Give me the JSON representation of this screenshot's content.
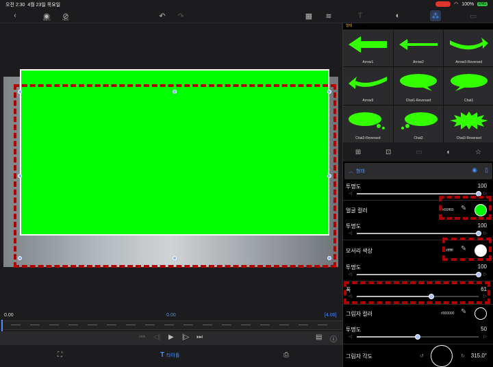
{
  "status_bar": {
    "time": "오전 2:30",
    "date": "4월 23일 목요일",
    "battery": "100%",
    "battery_badge": "ENG"
  },
  "toolbar": {
    "back_icon": "chevron-left-icon",
    "eye_label_1": "SOLO",
    "eye_label_2": "HIDE"
  },
  "timeline": {
    "start": "0.00",
    "current": "0.00",
    "end": "[4.00]",
    "title_tab": "타이틀"
  },
  "shape_panel": {
    "category": "형태",
    "shapes": [
      {
        "label": "Arrow1"
      },
      {
        "label": "Arrow2"
      },
      {
        "label": "Arrow3-Reversed"
      },
      {
        "label": "Arrow3"
      },
      {
        "label": "Chat1-Reversed"
      },
      {
        "label": "Chat1"
      },
      {
        "label": "Chat2-Reversed"
      },
      {
        "label": "Chat2"
      },
      {
        "label": "Chat3-Reversed"
      }
    ],
    "shape_color": "#33ff00"
  },
  "properties": {
    "section_title": "형태",
    "opacity_label": "투명도",
    "opacity1": "100",
    "opacity1_value": 1.0,
    "face_color_label": "얼굴 컬러",
    "face_color_hex": "#00ff00",
    "face_color": "#00ff00",
    "opacity2": "100",
    "opacity2_value": 1.0,
    "edge_color_label": "모서리 색상",
    "edge_color_hex": "#ffffff",
    "edge_color": "#ffffff",
    "opacity3": "100",
    "opacity3_value": 1.0,
    "width_label": "폭",
    "width": "61",
    "width_value": 0.61,
    "shadow_color_label": "그림자 컬러",
    "shadow_color_hex": "#000000",
    "shadow_opacity": "50",
    "shadow_opacity_value": 0.5,
    "shadow_angle_label": "그림자 각도",
    "shadow_angle": "315.0°"
  },
  "accent_color": "#4a90ff",
  "highlight_color": "#b00000"
}
